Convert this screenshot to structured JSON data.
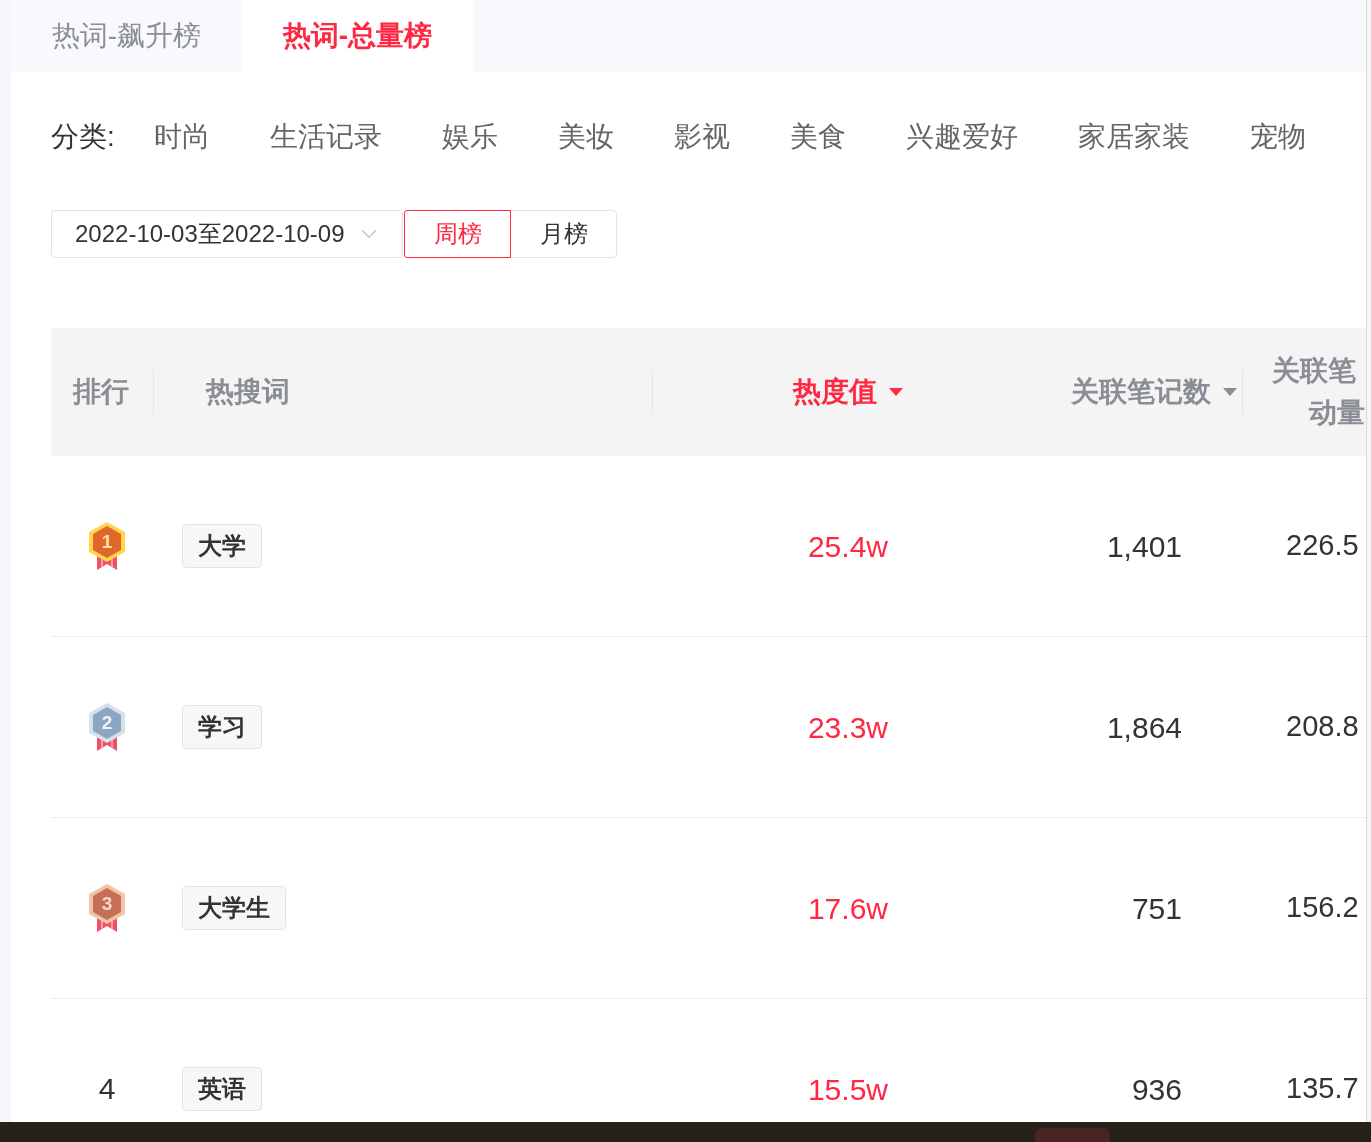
{
  "tabs": [
    {
      "label": "热词-飙升榜",
      "selected": false
    },
    {
      "label": "热词-总量榜",
      "selected": true
    }
  ],
  "category_filter": {
    "label": "分类:",
    "items": [
      "时尚",
      "生活记录",
      "娱乐",
      "美妆",
      "影视",
      "美食",
      "兴趣爱好",
      "家居家装",
      "宠物"
    ]
  },
  "date_range": {
    "value": "2022-10-03至2022-10-09"
  },
  "period_toggle": [
    {
      "label": "周榜",
      "selected": true
    },
    {
      "label": "月榜",
      "selected": false
    }
  ],
  "table": {
    "columns": [
      {
        "kind": "plain",
        "label": "排行"
      },
      {
        "kind": "plain",
        "label": "热搜词"
      },
      {
        "kind": "sortable",
        "label": "热度值",
        "sorted": true
      },
      {
        "kind": "sortable",
        "label": "关联笔记数",
        "sorted": false
      },
      {
        "kind": "wrapped",
        "lines": [
          "关联笔",
          "动量"
        ]
      }
    ],
    "rows": [
      {
        "kind": "gold",
        "rank": "1",
        "keyword": "大学",
        "heat": "25.4w",
        "notes": "1,401",
        "column_5": "226.5"
      },
      {
        "kind": "silver",
        "rank": "2",
        "keyword": "学习",
        "heat": "23.3w",
        "notes": "1,864",
        "column_5": "208.8"
      },
      {
        "kind": "bronze",
        "rank": "3",
        "keyword": "大学生",
        "heat": "17.6w",
        "notes": "751",
        "column_5": "156.2"
      },
      {
        "kind": "plain",
        "rank": "4",
        "keyword": "英语",
        "heat": "15.5w",
        "notes": "936",
        "column_5": "135.7"
      }
    ]
  }
}
